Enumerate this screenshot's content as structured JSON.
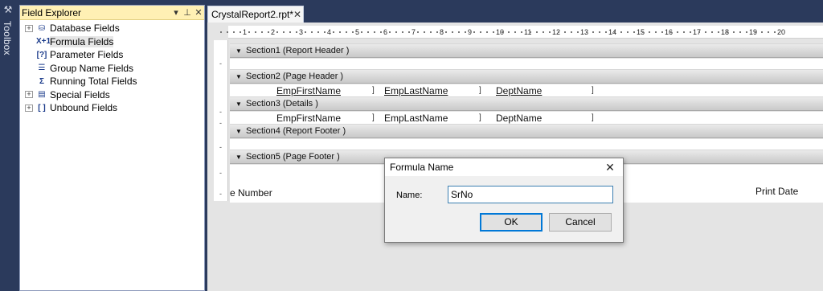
{
  "toolbox": {
    "label": "Toolbox",
    "icon": "toolbox-icon"
  },
  "field_explorer": {
    "title": "Field Explorer",
    "controls": [
      "▾",
      "⊥",
      "✕"
    ],
    "items": [
      {
        "label": "Database Fields",
        "icon": "database-icon",
        "glyph": "⛁",
        "expandable": true,
        "selected": false
      },
      {
        "label": "Formula Fields",
        "icon": "formula-icon",
        "glyph": "X+1",
        "expandable": false,
        "selected": true
      },
      {
        "label": "Parameter Fields",
        "icon": "parameter-icon",
        "glyph": "[?]",
        "expandable": false,
        "selected": false
      },
      {
        "label": "Group Name Fields",
        "icon": "group-icon",
        "glyph": "☰",
        "expandable": false,
        "selected": false
      },
      {
        "label": "Running Total Fields",
        "icon": "running-total-icon",
        "glyph": "Σ",
        "expandable": false,
        "selected": false
      },
      {
        "label": "Special Fields",
        "icon": "special-icon",
        "glyph": "▤",
        "expandable": true,
        "selected": false
      },
      {
        "label": "Unbound Fields",
        "icon": "unbound-icon",
        "glyph": "[ ]",
        "expandable": true,
        "selected": false
      }
    ]
  },
  "document": {
    "tab_label": "CrystalReport2.rpt*",
    "ruler_numbers": [
      "1",
      "2",
      "3",
      "4",
      "5",
      "6",
      "7",
      "8",
      "9",
      "10",
      "11",
      "12",
      "13",
      "14",
      "15",
      "16",
      "17",
      "18",
      "19",
      "20"
    ],
    "sections": [
      {
        "label": "Section1 (Report Header  )"
      },
      {
        "label": "Section2 (Page Header  )"
      },
      {
        "label": "Section3 (Details  )"
      },
      {
        "label": "Section4 (Report Footer  )"
      },
      {
        "label": "Section5 (Page Footer  )"
      }
    ],
    "header_fields": [
      "EmpFirstName",
      "EmpLastName",
      "DeptName"
    ],
    "detail_fields": [
      "EmpFirstName",
      "EmpLastName",
      "DeptName"
    ],
    "footer_left": "e Number",
    "footer_right": "Print Date"
  },
  "dialog": {
    "title": "Formula Name",
    "name_label": "Name:",
    "name_value": "SrNo",
    "ok_label": "OK",
    "cancel_label": "Cancel"
  }
}
